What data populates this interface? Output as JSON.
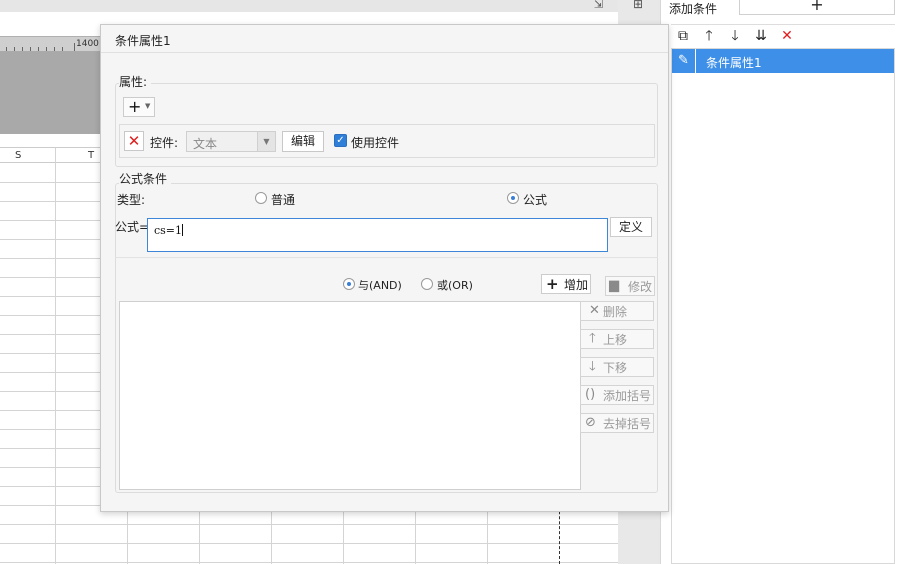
{
  "spreadsheet": {
    "ruler_label": "1400",
    "columns": [
      "S",
      "T"
    ]
  },
  "right_panel": {
    "add_condition_label": "添加条件",
    "add_plus": "+",
    "toolbar_icons": [
      "copy-icon",
      "arrow-up-icon",
      "arrow-down-icon",
      "move-bottom-icon",
      "delete-icon"
    ],
    "conditions": [
      {
        "label": "条件属性1",
        "selected": true
      }
    ]
  },
  "dialog": {
    "title": "条件属性1",
    "attributes": {
      "legend": "属性:",
      "add_button": "+",
      "control_label": "控件:",
      "control_type_value": "文本",
      "edit_button": "编辑",
      "use_control_label": "使用控件",
      "use_control_checked": true
    },
    "formula_section": {
      "legend": "公式条件",
      "type_label": "类型:",
      "type_options": [
        {
          "label": "普通",
          "selected": false
        },
        {
          "label": "公式",
          "selected": true
        }
      ],
      "formula_label": "公式=",
      "formula_value": "cs=1",
      "define_button": "定义",
      "logic_options": [
        {
          "label": "与(AND)",
          "selected": true
        },
        {
          "label": "或(OR)",
          "selected": false
        }
      ],
      "add_button": "增加",
      "modify_button": "修改",
      "delete_button": "删除",
      "move_up_button": "上移",
      "move_down_button": "下移",
      "add_bracket_button": "添加括号",
      "remove_bracket_button": "去掉括号"
    }
  },
  "colors": {
    "selection_blue": "#3d8fe8",
    "input_focus_border": "#3d86d8",
    "delete_red": "#e02020",
    "checkbox_blue": "#2f7fd8"
  }
}
